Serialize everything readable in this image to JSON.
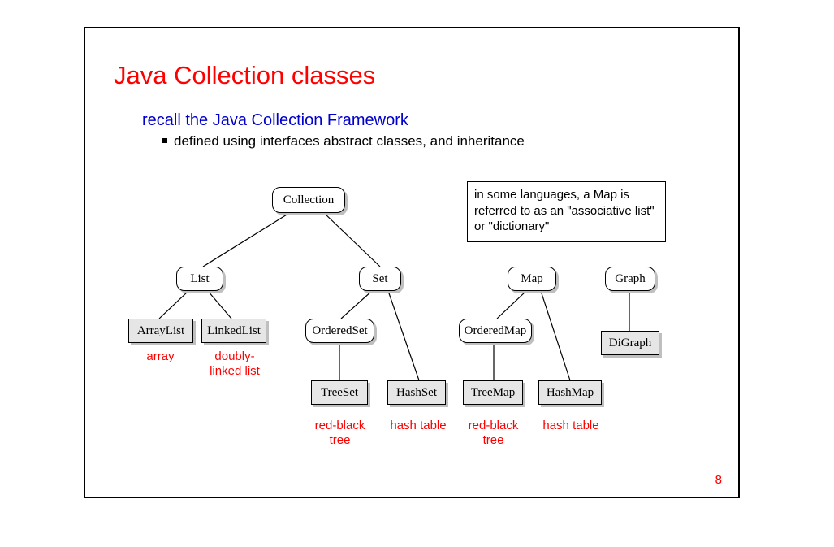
{
  "title": "Java Collection classes",
  "subtitle": "recall the Java Collection Framework",
  "bullet": "defined using interfaces abstract classes, and inheritance",
  "info_box": "in some languages, a Map is referred to as an \"associative list\" or \"dictionary\"",
  "page_number": "8",
  "nodes": {
    "collection": "Collection",
    "list": "List",
    "set": "Set",
    "map": "Map",
    "graph": "Graph",
    "arraylist": "ArrayList",
    "linkedlist": "LinkedList",
    "orderedset": "OrderedSet",
    "orderedmap": "OrderedMap",
    "digraph": "DiGraph",
    "treeset": "TreeSet",
    "hashset": "HashSet",
    "treemap": "TreeMap",
    "hashmap": "HashMap"
  },
  "impl_labels": {
    "arraylist": "array",
    "linkedlist": "doubly-\nlinked list",
    "treeset": "red-black\ntree",
    "hashset": "hash table",
    "treemap": "red-black\ntree",
    "hashmap": "hash table"
  }
}
